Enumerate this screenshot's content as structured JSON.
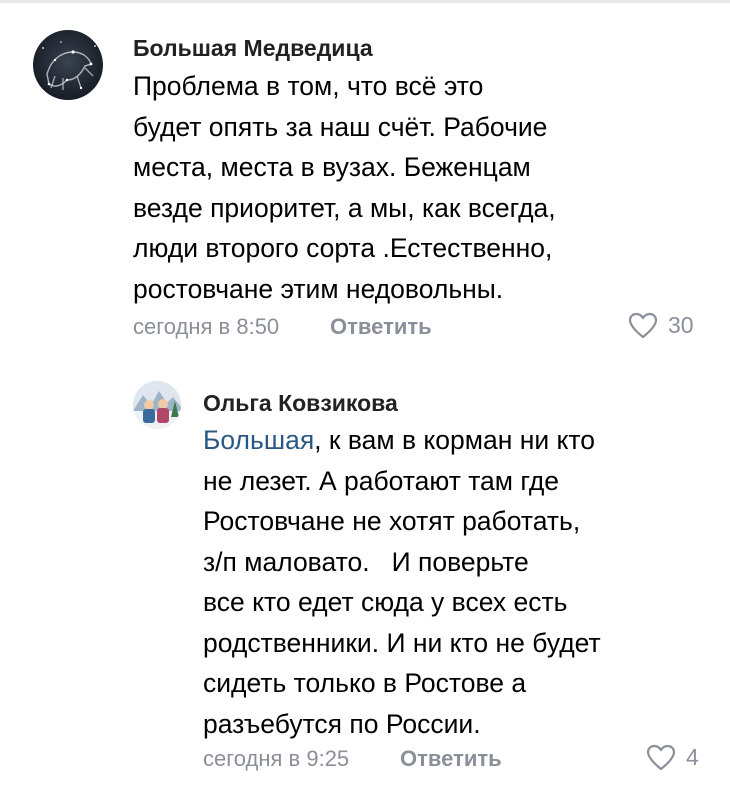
{
  "comments": [
    {
      "author": "Большая Медведица",
      "lines": [
        "Проблема в том, что всё это",
        "будет опять за наш счёт. Рабочие",
        "места, места в вузах. Беженцам",
        "везде приоритет, а мы, как всегда,",
        "люди второго сорта .Естественно,",
        "ростовчане этим недовольны."
      ],
      "time": "сегодня в 8:50",
      "reply_label": "Ответить",
      "likes": "30",
      "avatar_icon": "star-constellation-avatar"
    },
    {
      "author": "Ольга Ковзикова",
      "mention": "Большая",
      "first_line_rest": ", к вам в корман ни кто",
      "lines": [
        "не лезет. А работают там где",
        "Ростовчане не хотят работать,",
        "з/п маловато.   И поверьте",
        "все кто едет сюда у всех есть",
        "родственники. И ни кто не будет",
        "сидеть только в Ростове а",
        "разъебутся по России."
      ],
      "time": "сегодня в 9:25",
      "reply_label": "Ответить",
      "likes": "4",
      "avatar_icon": "photo-avatar"
    }
  ],
  "colors": {
    "author": "#222222",
    "mention": "#2a5885",
    "meta": "#8a8f99",
    "divider": "#e7e8ec"
  }
}
